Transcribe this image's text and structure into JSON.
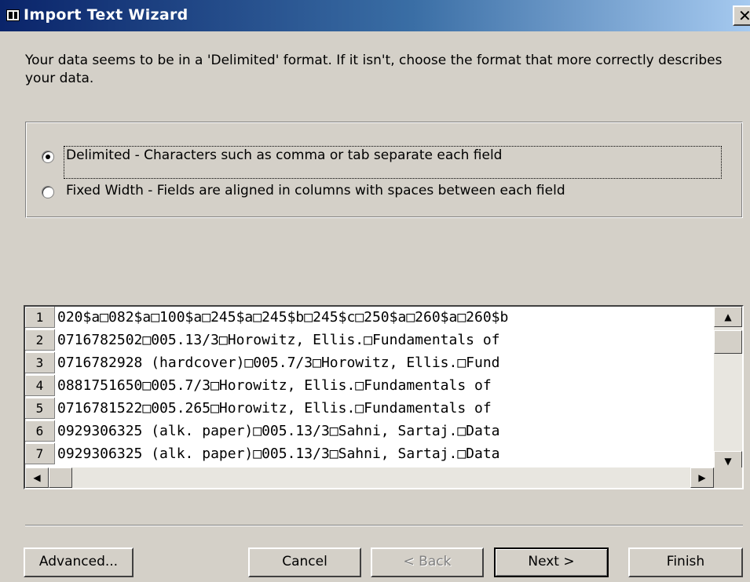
{
  "window": {
    "title": "Import Text Wizard",
    "close_glyph": "✕"
  },
  "instructions": "Your data seems to be in a 'Delimited' format. If it isn't, choose the format that more correctly describes your data.",
  "format_options": [
    {
      "label": "Delimited - Characters such as comma or tab separate each field",
      "selected": true
    },
    {
      "label": "Fixed Width - Fields are aligned in columns with spaces between each field",
      "selected": false
    }
  ],
  "preview": {
    "rows": [
      {
        "num": "1",
        "text": "020$a□082$a□100$a□245$a□245$b□245$c□250$a□260$a□260$b"
      },
      {
        "num": "2",
        "text": "0716782502□005.13/3□Horowitz, Ellis.□Fundamentals of"
      },
      {
        "num": "3",
        "text": "0716782928 (hardcover)□005.7/3□Horowitz, Ellis.□Fund"
      },
      {
        "num": "4",
        "text": "0881751650□005.7/3□Horowitz, Ellis.□Fundamentals of"
      },
      {
        "num": "5",
        "text": "0716781522□005.265□Horowitz, Ellis.□Fundamentals of"
      },
      {
        "num": "6",
        "text": "0929306325 (alk. paper)□005.13/3□Sahni, Sartaj.□Data"
      },
      {
        "num": "7",
        "text": "0929306325 (alk. paper)□005.13/3□Sahni, Sartaj.□Data"
      }
    ]
  },
  "scrollbar_glyphs": {
    "up": "▲",
    "down": "▼",
    "left": "◀",
    "right": "▶"
  },
  "buttons": {
    "advanced": "Advanced...",
    "cancel": "Cancel",
    "back": "< Back",
    "next": "Next >",
    "finish": "Finish"
  }
}
